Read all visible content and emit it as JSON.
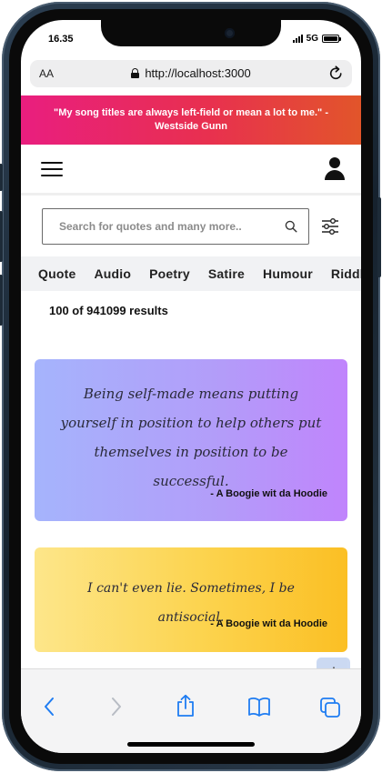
{
  "status_bar": {
    "time": "16.35",
    "network": "5G"
  },
  "browser": {
    "text_size_label": "AA",
    "url": "http://localhost:3000"
  },
  "banner": {
    "quote": "\"My song titles are always left-field or mean a lot to me.\" - Westside Gunn"
  },
  "search": {
    "placeholder": "Search for quotes and many more.."
  },
  "categories": [
    "Quote",
    "Audio",
    "Poetry",
    "Satire",
    "Humour",
    "Riddle"
  ],
  "results": {
    "count_text": "100 of 941099 results"
  },
  "cards": [
    {
      "text": "Being self-made means putting yourself in position to help others put themselves in position to be successful.",
      "author": "- A Boogie wit da Hoodie"
    },
    {
      "text": "I can't even lie. Sometimes, I be antisocial.",
      "author": "- A Boogie wit da Hoodie"
    }
  ],
  "colors": {
    "banner_gradient": [
      "#e91e7f",
      "#e2552a"
    ],
    "card1_gradient": [
      "#a5b4fc",
      "#c084fc"
    ],
    "card2_gradient": [
      "#fde68a",
      "#fbbf24"
    ],
    "card3_gradient": [
      "#f472b6",
      "#db2777"
    ],
    "safari_blue": "#1e7cf2"
  },
  "icons": {
    "menu": "hamburger-icon",
    "account": "user-icon",
    "search": "search-icon",
    "filter": "sliders-icon",
    "scroll": "arrow-down-icon",
    "toolbar": [
      "chevron-left-icon",
      "chevron-right-icon",
      "share-icon",
      "book-icon",
      "tabs-icon"
    ]
  }
}
